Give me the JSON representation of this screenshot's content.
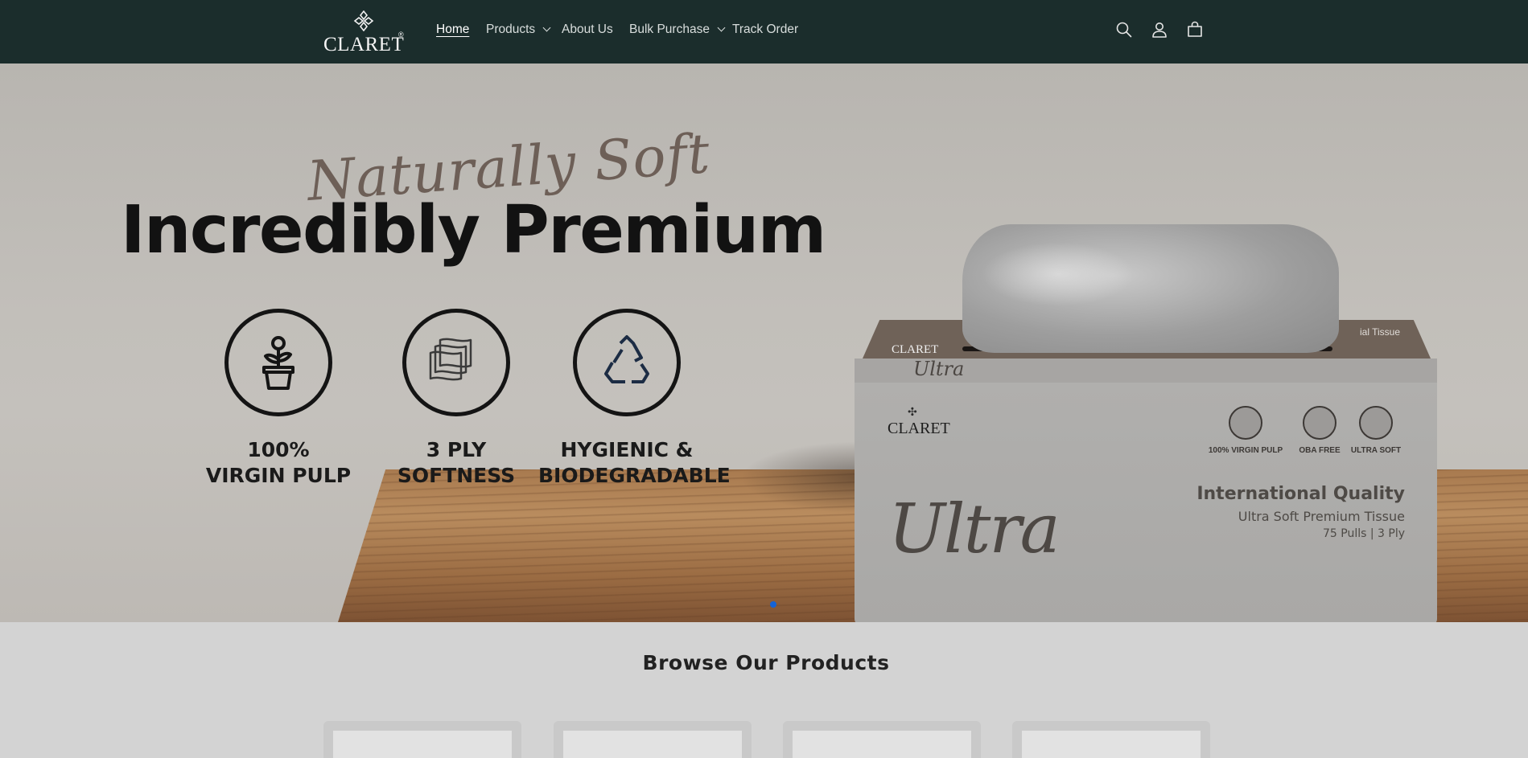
{
  "header": {
    "logo_text": "CLARET",
    "logo_reg": "®",
    "nav": [
      {
        "label": "Home",
        "active": true,
        "has_dropdown": false
      },
      {
        "label": "Products",
        "active": false,
        "has_dropdown": true
      },
      {
        "label": "About Us",
        "active": false,
        "has_dropdown": false
      },
      {
        "label": "Bulk Purchase",
        "active": false,
        "has_dropdown": true
      },
      {
        "label": "Track Order",
        "active": false,
        "has_dropdown": false
      }
    ],
    "icons": [
      "search-icon",
      "account-icon",
      "cart-icon"
    ]
  },
  "hero": {
    "script_text": "Naturally Soft",
    "title": "Incredibly Premium",
    "features": [
      {
        "icon": "plant-pot-icon",
        "line1": "100%",
        "line2": "VIRGIN PULP"
      },
      {
        "icon": "tissue-layers-icon",
        "line1": "3 PLY",
        "line2": "SOFTNESS"
      },
      {
        "icon": "recycle-icon",
        "line1": "HYGIENIC &",
        "line2": "BIODEGRADABLE"
      }
    ],
    "product_box": {
      "brand": "CLARET",
      "brand_small": "CLARET",
      "ultra_script": "Ultra",
      "ultra_script_small": "Ultra",
      "top_text": "ial Tissue",
      "headline": "International Quality",
      "subline": "Ultra Soft Premium Tissue",
      "specs": "75 Pulls | 3 Ply",
      "badges": [
        "100% VIRGIN PULP",
        "OBA FREE",
        "ULTRA SOFT"
      ]
    },
    "slider": {
      "active_index": 0,
      "accent": "#1463d6"
    }
  },
  "browse": {
    "title": "Browse Our Products",
    "card_count": 4
  },
  "colors": {
    "header_bg": "#1b2d2c",
    "page_bg": "#d3d3d3"
  }
}
